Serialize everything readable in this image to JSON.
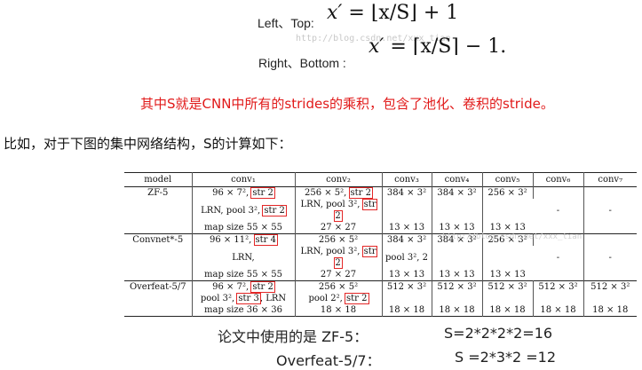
{
  "formula": {
    "top_label": "Left、Top:",
    "bottom_label": "Right、Bottom :",
    "top_expr_lhs": "x′",
    "top_expr_rhs": "= ⌊x/S⌋ + 1",
    "bottom_expr_lhs": "x′",
    "bottom_expr_rhs": "= ⌈x/S⌉ − 1.",
    "watermark": "http://blog.csdn.net/xxx_tian"
  },
  "note_red": "其中S就是CNN中所有的strides的乘积，包含了池化、卷积的stride。",
  "intro": "比如，对于下图的集中网络结构，S的计算如下：",
  "table": {
    "headers": [
      "model",
      "conv₁",
      "conv₂",
      "conv₃",
      "conv₄",
      "conv₅",
      "conv₆",
      "conv₇"
    ],
    "zf": {
      "model": "ZF-5",
      "c1": [
        "96 × 7², ",
        "str 2",
        "LRN, pool 3², ",
        "str 2",
        "map size 55 × 55"
      ],
      "c2": [
        "256 × 5², ",
        "str 2",
        "LRN, pool 3², ",
        "str 2",
        "27 × 27"
      ],
      "c3": [
        "384 × 3²",
        "13 × 13"
      ],
      "c4": [
        "384 × 3²",
        "13 × 13"
      ],
      "c5": [
        "256 × 3²",
        "13 × 13"
      ],
      "c6": "-",
      "c7": "-"
    },
    "convnet": {
      "model": "Convnet*-5",
      "c1": [
        "96 × 11², ",
        "str 4",
        "LRN,",
        "map size 55 × 55"
      ],
      "c2": [
        "256 × 5²",
        "LRN, pool 3², ",
        "str 2",
        "27 × 27"
      ],
      "c3": [
        "384 × 3²",
        "pool 3², 2",
        "13 × 13"
      ],
      "c4": [
        "384 × 3²",
        "13 × 13"
      ],
      "c5": [
        "256 × 3²",
        "13 × 13"
      ],
      "c6": "-",
      "c7": "-"
    },
    "overfeat": {
      "model": "Overfeat-5/7",
      "c1": [
        "96 × 7², ",
        "str 2",
        "pool 3², ",
        "str 3",
        ", LRN",
        "map size 36 × 36"
      ],
      "c2": [
        "256 × 5²",
        "pool 2², ",
        "str 2",
        "18 × 18"
      ],
      "c3": [
        "512 × 3²",
        "18 × 18"
      ],
      "c4": [
        "512 × 3²",
        "18 × 18"
      ],
      "c5": [
        "512 × 3²",
        "18 × 18"
      ],
      "c6": [
        "512 × 3²",
        "18 × 18"
      ],
      "c7": [
        "512 × 3²",
        "18 × 18"
      ]
    },
    "watermark": "http://blog.csdn.net/xxx_tian"
  },
  "summary": {
    "zf_label": "论文中使用的是 ZF-5：",
    "zf_value": "S=2*2*2*2=16",
    "of_label": "Overfeat-5/7：",
    "of_value": "S =2*3*2 =12"
  },
  "colors": {
    "highlight": "#e32626",
    "note": "#e11a1a"
  }
}
